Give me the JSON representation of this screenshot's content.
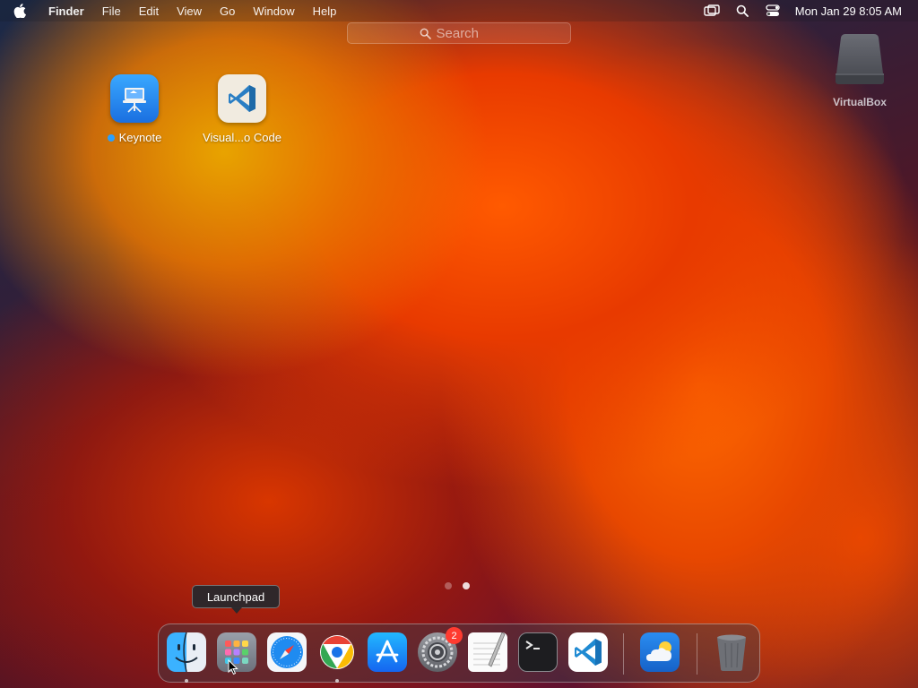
{
  "menubar": {
    "apple_icon": "apple-logo-icon",
    "app_name": "Finder",
    "items": [
      "File",
      "Edit",
      "View",
      "Go",
      "Window",
      "Help"
    ],
    "status_icons": [
      "screen-mirroring-icon",
      "spotlight-search-icon",
      "control-center-icon"
    ],
    "clock": "Mon Jan 29  8:05 AM"
  },
  "launchpad": {
    "search_placeholder": "Search",
    "apps": [
      {
        "label": "Keynote",
        "icon": "keynote-icon",
        "new_indicator": true
      },
      {
        "label": "Visual...o Code",
        "icon": "vscode-icon",
        "new_indicator": false
      }
    ],
    "pages": 2,
    "current_page": 2
  },
  "desktop": {
    "drive_label": "VirtualBox",
    "drive_icon": "external-drive-icon"
  },
  "tooltip": {
    "text": "Launchpad"
  },
  "dock": {
    "items": [
      {
        "name": "Finder",
        "icon": "finder-icon",
        "running": true
      },
      {
        "name": "Launchpad",
        "icon": "launchpad-icon",
        "running": false
      },
      {
        "name": "Safari",
        "icon": "safari-icon",
        "running": false
      },
      {
        "name": "Google Chrome",
        "icon": "chrome-icon",
        "running": true
      },
      {
        "name": "App Store",
        "icon": "app-store-icon",
        "running": false
      },
      {
        "name": "System Settings",
        "icon": "system-settings-icon",
        "running": false,
        "badge": "2"
      },
      {
        "name": "TextEdit",
        "icon": "textedit-icon",
        "running": false
      },
      {
        "name": "Terminal",
        "icon": "terminal-icon",
        "running": false
      },
      {
        "name": "Visual Studio Code",
        "icon": "vscode-icon",
        "running": false
      },
      {
        "name": "Weather",
        "icon": "weather-icon",
        "running": false
      },
      {
        "name": "Trash",
        "icon": "trash-icon",
        "running": false
      }
    ]
  },
  "colors": {
    "badge": "#ff3b30",
    "new_dot": "#2aa0ff",
    "vscode_blue": "#1f8ad2"
  }
}
